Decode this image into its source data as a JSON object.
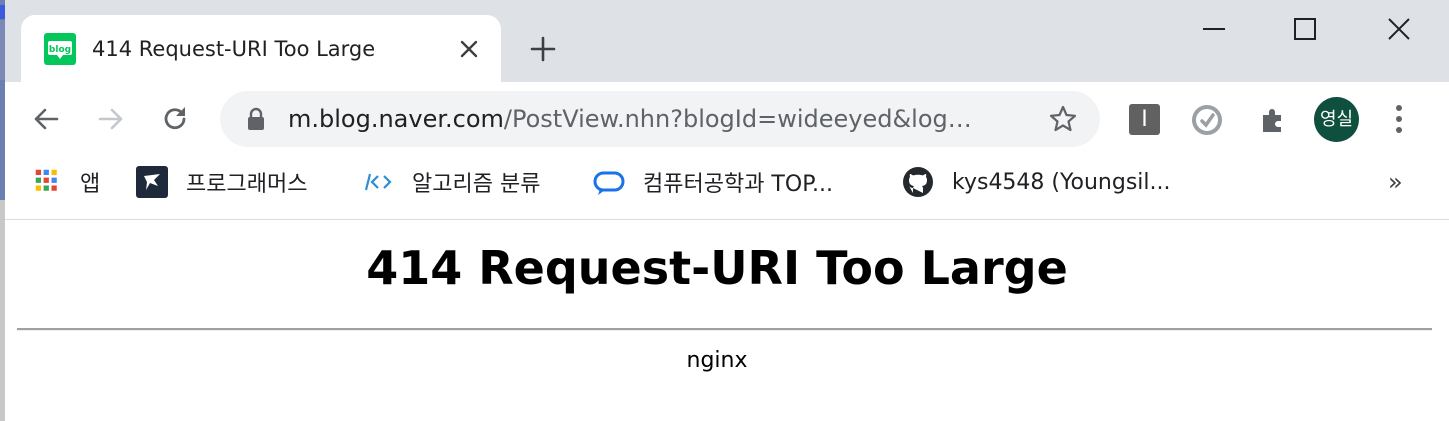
{
  "tab": {
    "title": "414 Request-URI Too Large",
    "favicon_text": "blog"
  },
  "toolbar": {
    "url_host": "m.blog.naver.com",
    "url_path": "/PostView.nhn?blogId=wideeyed&log…",
    "extension_label": "I",
    "profile_label": "영실"
  },
  "bookmarks": {
    "items": [
      {
        "label": "앱",
        "icon": "apps-grid-icon"
      },
      {
        "label": "프로그래머스",
        "icon": "programmers-icon"
      },
      {
        "label": "알고리즘 분류",
        "icon": "code-brackets-icon"
      },
      {
        "label": "컴퓨터공학과 TOP...",
        "icon": "chat-bubble-icon"
      },
      {
        "label": "kys4548 (Youngsil...",
        "icon": "github-icon"
      }
    ],
    "more_label": "»"
  },
  "page": {
    "heading": "414 Request-URI Too Large",
    "server": "nginx"
  },
  "colors": {
    "tab_strip": "#dee1e6",
    "omnibox": "#f1f3f4",
    "favicon_green": "#03c75a",
    "avatar": "#0f4f3d"
  }
}
